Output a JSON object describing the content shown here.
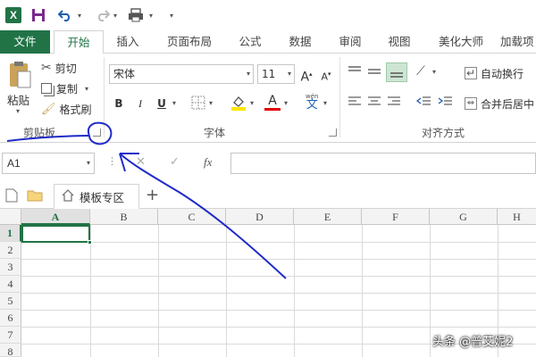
{
  "quick_access": {
    "app_logo": "X",
    "icons": [
      "excel-logo",
      "save-icon",
      "undo-icon",
      "redo-icon",
      "print-preview-icon",
      "customize-icon"
    ]
  },
  "tabs": {
    "file": "文件",
    "items": [
      "开始",
      "插入",
      "页面布局",
      "公式",
      "数据",
      "审阅",
      "视图",
      "美化大师",
      "加载项"
    ],
    "active": "开始"
  },
  "clipboard": {
    "paste": "粘贴",
    "cut": "剪切",
    "copy": "复制",
    "format_painter": "格式刷",
    "group_label": "剪贴板"
  },
  "font": {
    "name": "宋体",
    "size": "11",
    "grow": "A",
    "shrink": "A",
    "bold": "B",
    "italic": "I",
    "underline": "U",
    "font_color": "A",
    "phonetic": "wén",
    "phonetic_char": "文",
    "group_label": "字体"
  },
  "alignment": {
    "wrap_text": "自动换行",
    "merge_center": "合并后居中",
    "group_label": "对齐方式"
  },
  "formula_bar": {
    "name_box": "A1",
    "cancel": "✕",
    "enter": "✓",
    "fx": "fx",
    "value": ""
  },
  "sheet_tabs": {
    "template_tab": "模板专区",
    "add": "+"
  },
  "grid": {
    "columns": [
      "A",
      "B",
      "C",
      "D",
      "E",
      "F",
      "G",
      "H"
    ],
    "rows": [
      "1",
      "2",
      "3",
      "4",
      "5",
      "6",
      "7",
      "8"
    ],
    "selected_cell": "A1"
  },
  "watermark": "头条 @普艾妮2",
  "colors": {
    "accent": "#217346",
    "annotation": "#1f2bc8"
  }
}
